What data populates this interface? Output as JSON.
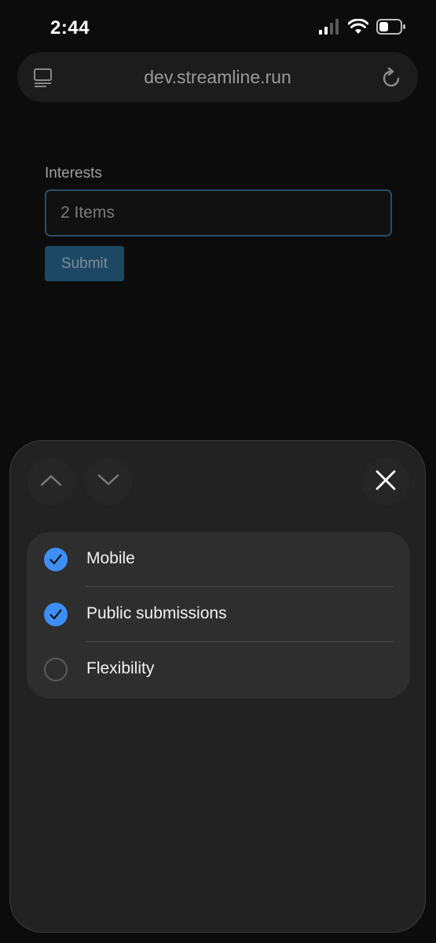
{
  "status_bar": {
    "time": "2:44",
    "icons": [
      "signal-icon",
      "wifi-icon",
      "battery-icon"
    ]
  },
  "browser": {
    "url": "dev.streamline.run",
    "left_icon": "tabs-icon",
    "right_icon": "reload-icon"
  },
  "form": {
    "interests_label": "Interests",
    "interests_value": "2 Items",
    "submit_label": "Submit"
  },
  "picker": {
    "prev_icon": "chevron-up-icon",
    "next_icon": "chevron-down-icon",
    "close_icon": "close-icon",
    "options": [
      {
        "label": "Mobile",
        "checked": true
      },
      {
        "label": "Public submissions",
        "checked": true
      },
      {
        "label": "Flexibility",
        "checked": false
      }
    ]
  },
  "colors": {
    "accent": "#3e8ef7",
    "input_border": "#2a4d66",
    "submit_bg": "#1d4863",
    "sheet_bg": "#222222"
  }
}
